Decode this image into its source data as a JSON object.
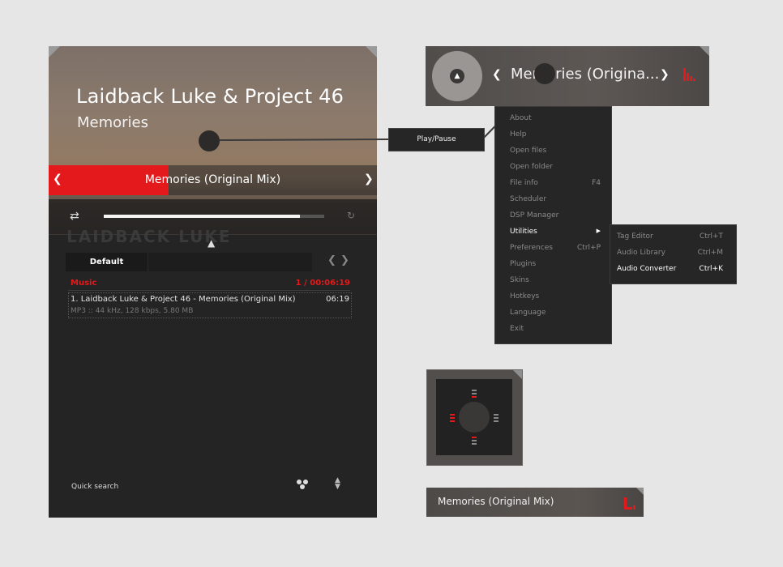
{
  "player": {
    "artist": "Laidback Luke & Project 46",
    "song": "Memories",
    "ticker_title": "Memories (Original Mix)",
    "background_text": "LAIDBACK LUKE",
    "progress_fraction": 0.89,
    "playlist_tab": "Default",
    "group_name": "Music",
    "group_stats": "1 / 00:06:19",
    "track_title": "1. Laidback Luke & Project 46 - Memories (Original Mix)",
    "track_duration": "06:19",
    "track_info": "MP3 :: 44 kHz, 128 kbps, 5.80 MB",
    "quick_search": "Quick search"
  },
  "callout": {
    "label": "Play/Pause"
  },
  "mini": {
    "title": "Memories (Origina..."
  },
  "menu": {
    "items": [
      {
        "label": "About",
        "shortcut": ""
      },
      {
        "label": "Help",
        "shortcut": ""
      },
      {
        "label": "Open files",
        "shortcut": ""
      },
      {
        "label": "Open folder",
        "shortcut": ""
      },
      {
        "label": "File info",
        "shortcut": "F4"
      },
      {
        "label": "Scheduler",
        "shortcut": ""
      },
      {
        "label": "DSP Manager",
        "shortcut": ""
      },
      {
        "label": "Utilities",
        "shortcut": ""
      },
      {
        "label": "Preferences",
        "shortcut": "Ctrl+P"
      },
      {
        "label": "Plugins",
        "shortcut": ""
      },
      {
        "label": "Skins",
        "shortcut": ""
      },
      {
        "label": "Hotkeys",
        "shortcut": ""
      },
      {
        "label": "Language",
        "shortcut": ""
      },
      {
        "label": "Exit",
        "shortcut": ""
      }
    ],
    "submenu": [
      {
        "label": "Tag Editor",
        "shortcut": "Ctrl+T"
      },
      {
        "label": "Audio Library",
        "shortcut": "Ctrl+M"
      },
      {
        "label": "Audio Converter",
        "shortcut": "Ctrl+K"
      }
    ]
  },
  "tiny": {
    "title": "Memories (Original Mix)"
  },
  "colors": {
    "accent": "#e3191b",
    "background": "#e6e6e6",
    "panel": "#242424"
  }
}
